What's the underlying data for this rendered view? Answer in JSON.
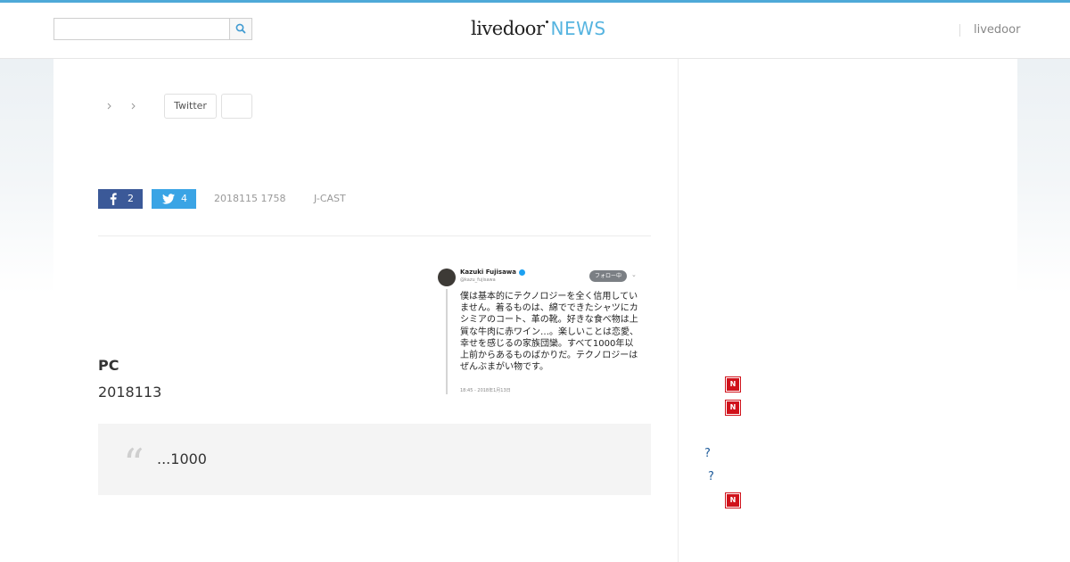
{
  "header": {
    "search": {
      "placeholder": "",
      "value": "",
      "button_icon": "search-icon"
    },
    "logo": {
      "main": "livedoor",
      "news": "NEWS"
    },
    "nav_link": "livedoor"
  },
  "breadcrumb": {
    "items": [
      "",
      "",
      ""
    ],
    "tags": [
      "Twitter",
      ""
    ]
  },
  "share": {
    "facebook": {
      "icon": "facebook-icon",
      "count": "2"
    },
    "twitter": {
      "icon": "twitter-icon",
      "count": "4"
    }
  },
  "article": {
    "date": "2018115 1758",
    "source": "J-CAST",
    "heading": "PC",
    "subheading_date": "2018113",
    "quote": "...1000",
    "tweet": {
      "name": "Kazuki Fujisawa",
      "handle": "@kazu_fujisawa",
      "follow_label": "フォロー中",
      "text": "僕は基本的にテクノロジーを全く信用していません。着るものは、綿でできたシャツにカシミアのコート、革の靴。好きな食べ物は上質な牛肉に赤ワイン…。楽しいことは恋愛、幸せを感じるの家族団欒。すべて1000年以上前からあるものばかりだ。テクノロジーはぜんぶまがい物です。",
      "timestamp": "18:45 - 2018年1月13日"
    }
  },
  "sidebar": {
    "badges": [
      "N",
      "N",
      "N"
    ],
    "questions": [
      "?",
      "?"
    ]
  },
  "colors": {
    "accent_bar": "#4ea9d8",
    "logo_news": "#56b4e0",
    "facebook": "#3b5998",
    "twitter": "#3aa4e5",
    "badge_red": "#d0121b",
    "link_blue": "#1e5b9a"
  }
}
